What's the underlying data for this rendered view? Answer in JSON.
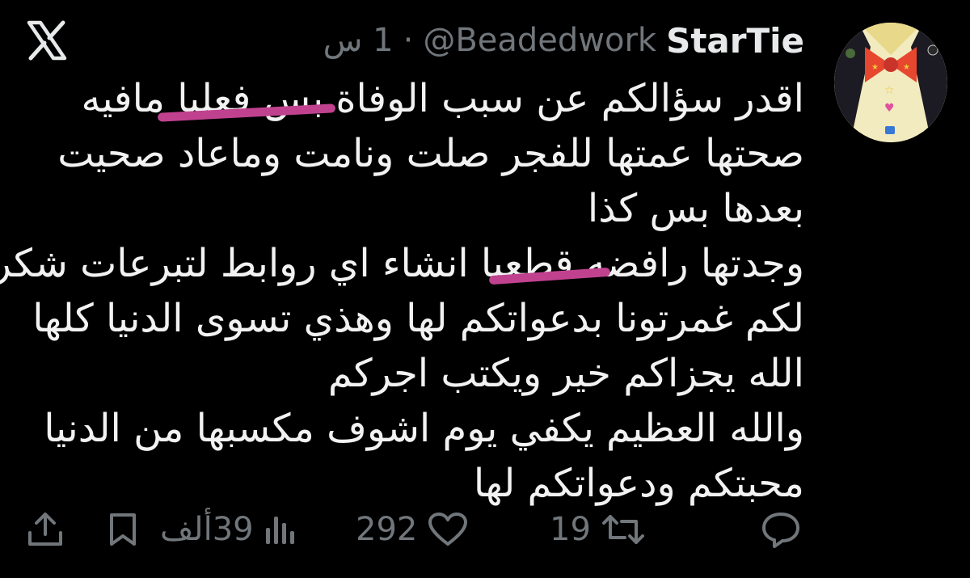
{
  "app": {
    "logo_icon": "x-logo-icon"
  },
  "author": {
    "display_name": "StarTie",
    "handle": "@Beadedwork",
    "separator": "·",
    "time": "1 س",
    "avatar_icon": "avatar-drawing-bowtie"
  },
  "tweet": {
    "lines": [
      "اقدر سؤالكم عن سبب الوفاة بس فعليا مافيه",
      "صحتها عمتها للفجر صلت ونامت وماعاد صحيت",
      "بعدها بس كذا",
      "وجدتها رافضه قطعيا انشاء اي روابط لتبرعات شكرا",
      "لكم غمرتونا بدعواتكم لها وهذي تسوى الدنيا كلها",
      "الله يجزاكم خير ويكتب اجركم",
      "والله العظيم يكفي يوم اشوف مكسبها من الدنيا",
      "محبتكم ودعواتكم لها"
    ],
    "highlight_color": "#c0428f"
  },
  "actions": {
    "reply": {
      "icon": "reply-icon",
      "count": ""
    },
    "repost": {
      "icon": "repost-icon",
      "count": "19"
    },
    "like": {
      "icon": "heart-icon",
      "count": "292"
    },
    "views": {
      "icon": "views-icon",
      "count": "39ألف"
    },
    "bookmark": {
      "icon": "bookmark-icon"
    },
    "share": {
      "icon": "share-icon"
    }
  },
  "colors": {
    "background": "#000000",
    "text": "#e7e9ea",
    "muted": "#71767b"
  }
}
